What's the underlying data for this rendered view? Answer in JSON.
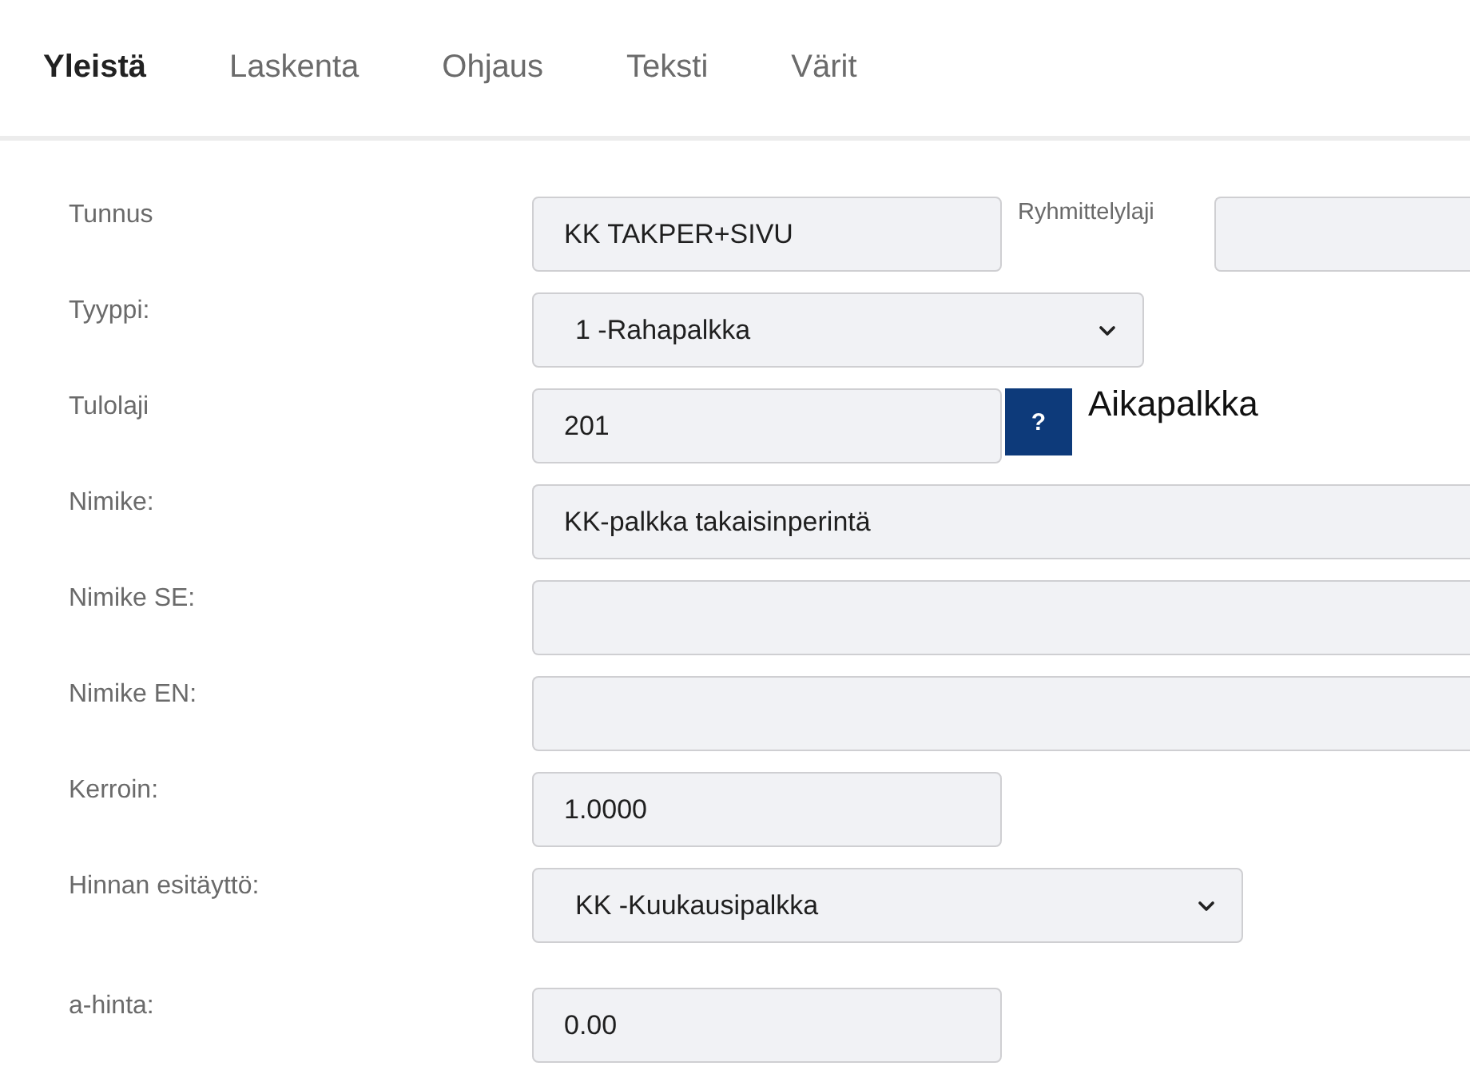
{
  "tabs": [
    {
      "label": "Yleistä",
      "selected": true
    },
    {
      "label": "Laskenta",
      "selected": false
    },
    {
      "label": "Ohjaus",
      "selected": false
    },
    {
      "label": "Teksti",
      "selected": false
    },
    {
      "label": "Värit",
      "selected": false
    }
  ],
  "form": {
    "rows": [
      {
        "label": "Tunnus",
        "kind": "text",
        "value": "KK TAKPER+SIVU",
        "side_field": {
          "label": "Ryhmittelylaji"
        }
      },
      {
        "label": "Tyyppi:",
        "kind": "select",
        "value": "1 -Rahapalkka"
      },
      {
        "label": "Tulolaji",
        "kind": "text",
        "value": "201",
        "help_button": "?",
        "description": "Aikapalkka"
      },
      {
        "label": "Nimike:",
        "kind": "text",
        "value": "KK-palkka takaisinperintä"
      },
      {
        "label": "Nimike SE:",
        "kind": "text"
      },
      {
        "label": "Nimike EN:",
        "kind": "text"
      },
      {
        "label": "Kerroin:",
        "kind": "text",
        "value": "1.0000"
      },
      {
        "label": "Hinnan esitäyttö:",
        "kind": "select",
        "value": "KK -Kuukausipalkka"
      },
      {
        "label": "a-hinta:",
        "kind": "text",
        "value": "0.00"
      }
    ]
  }
}
